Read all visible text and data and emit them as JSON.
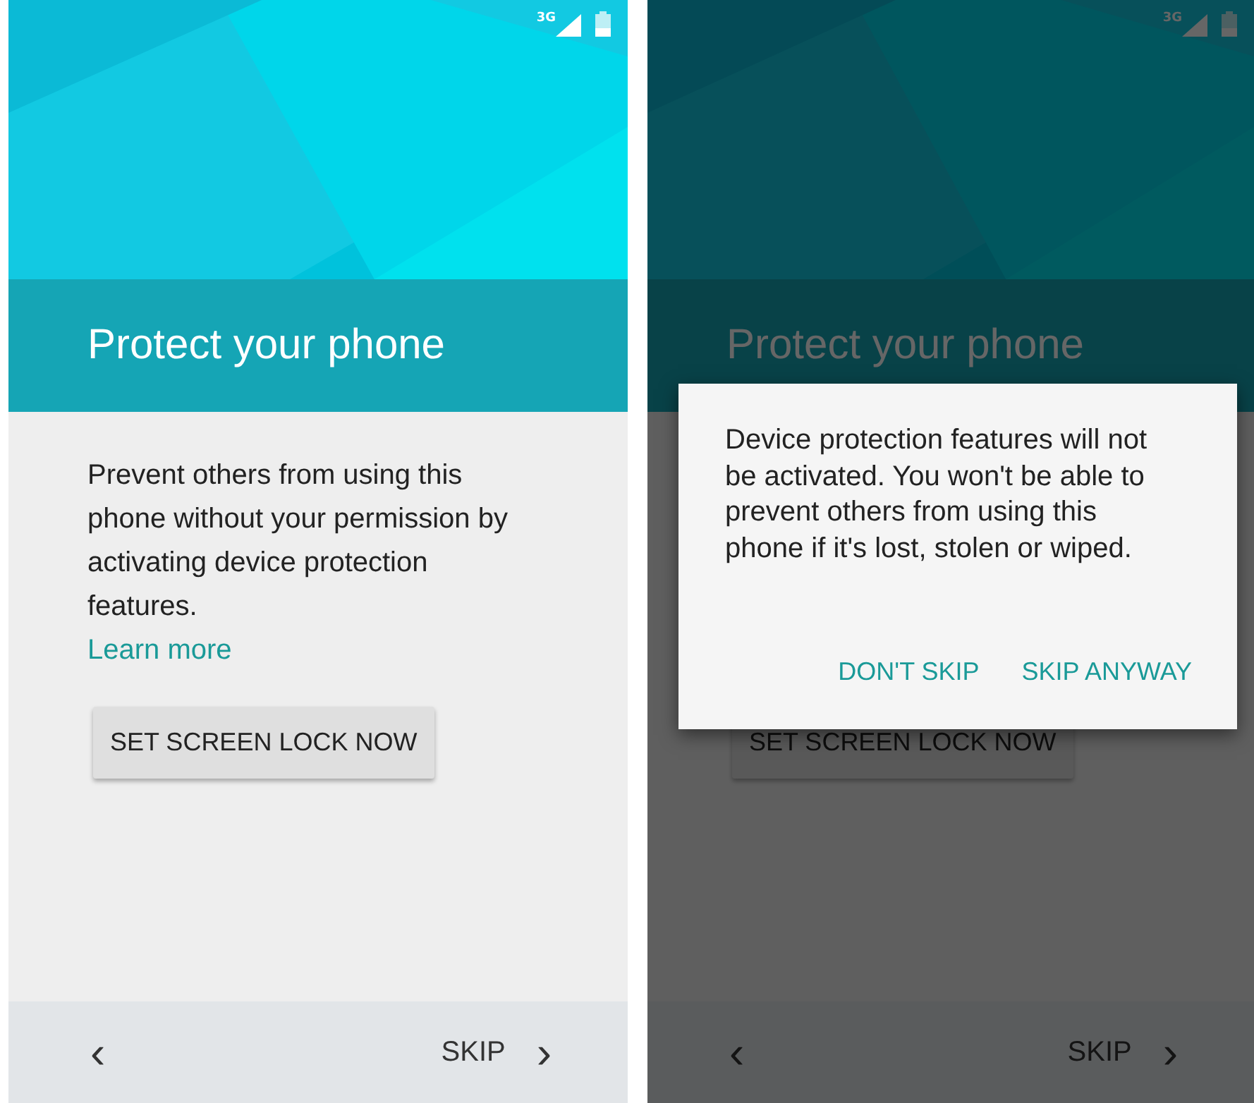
{
  "screens": [
    {
      "status_bar": {
        "network": "3G"
      },
      "title": "Protect your phone",
      "body": "Prevent others from using this phone without your permission by activating device protection features.",
      "link": "Learn more",
      "action_button": "SET SCREEN LOCK NOW",
      "footer": {
        "back": "‹",
        "skip": "SKIP",
        "next": "›"
      }
    },
    {
      "status_bar": {
        "network": "3G"
      },
      "title": "Protect your phone",
      "action_button": "SET SCREEN LOCK NOW",
      "footer": {
        "back": "‹",
        "skip": "SKIP",
        "next": "›"
      },
      "dialog": {
        "message": "Device protection features will not be activated. You won't be able to prevent others from using this phone if it's lost, stolen or wiped.",
        "buttons": [
          "DON'T SKIP",
          "SKIP ANYWAY"
        ]
      }
    }
  ]
}
